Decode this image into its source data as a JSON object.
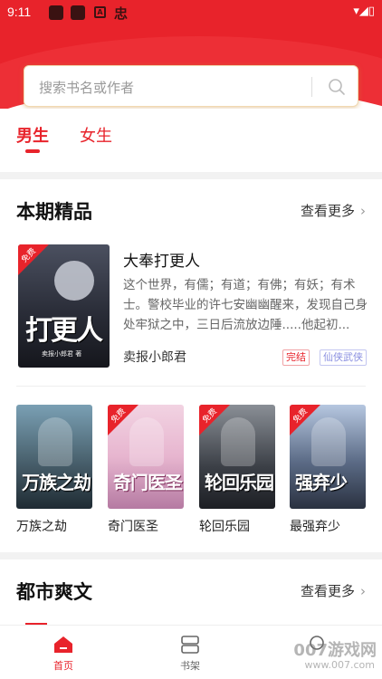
{
  "status_bar": {
    "time": "9:11",
    "right_icons": "▾◢▯"
  },
  "search": {
    "placeholder": "搜索书名或作者"
  },
  "gender_tabs": [
    {
      "label": "男生"
    },
    {
      "label": "女生"
    }
  ],
  "section1": {
    "title": "本期精品",
    "more_label": "查看更多",
    "featured": {
      "title": "大奉打更人",
      "description": "这个世界，有儒；有道；有佛；有妖；有术士。警校毕业的许七安幽幽醒来，发现自己身处牢狱之中，三日后流放边陲.....他起初...",
      "author": "卖报小郎君",
      "status_tag": "完结",
      "category_tag": "仙侠武侠",
      "badge": "免费",
      "cover_text": "打更人",
      "cover_sub": "卖报小郎君 著"
    },
    "books": [
      {
        "name": "万族之劫",
        "cover_text": "万族之劫",
        "badge": "免费"
      },
      {
        "name": "奇门医圣",
        "cover_text": "奇门医圣",
        "badge": "免费"
      },
      {
        "name": "轮回乐园",
        "cover_text": "轮回乐园",
        "badge": "免费"
      },
      {
        "name": "最强弃少",
        "cover_text": "强弃少",
        "badge": "免费"
      }
    ]
  },
  "section2": {
    "title": "都市爽文",
    "more_label": "查看更多"
  },
  "bottom_nav": [
    {
      "label": "首页",
      "icon": "home-icon"
    },
    {
      "label": "书架",
      "icon": "bookshelf-icon"
    },
    {
      "label": "",
      "icon": "profile-icon"
    }
  ],
  "watermark": {
    "line1": "007游戏网",
    "line2": "www.007.com"
  },
  "colors": {
    "accent": "#e8232b"
  }
}
